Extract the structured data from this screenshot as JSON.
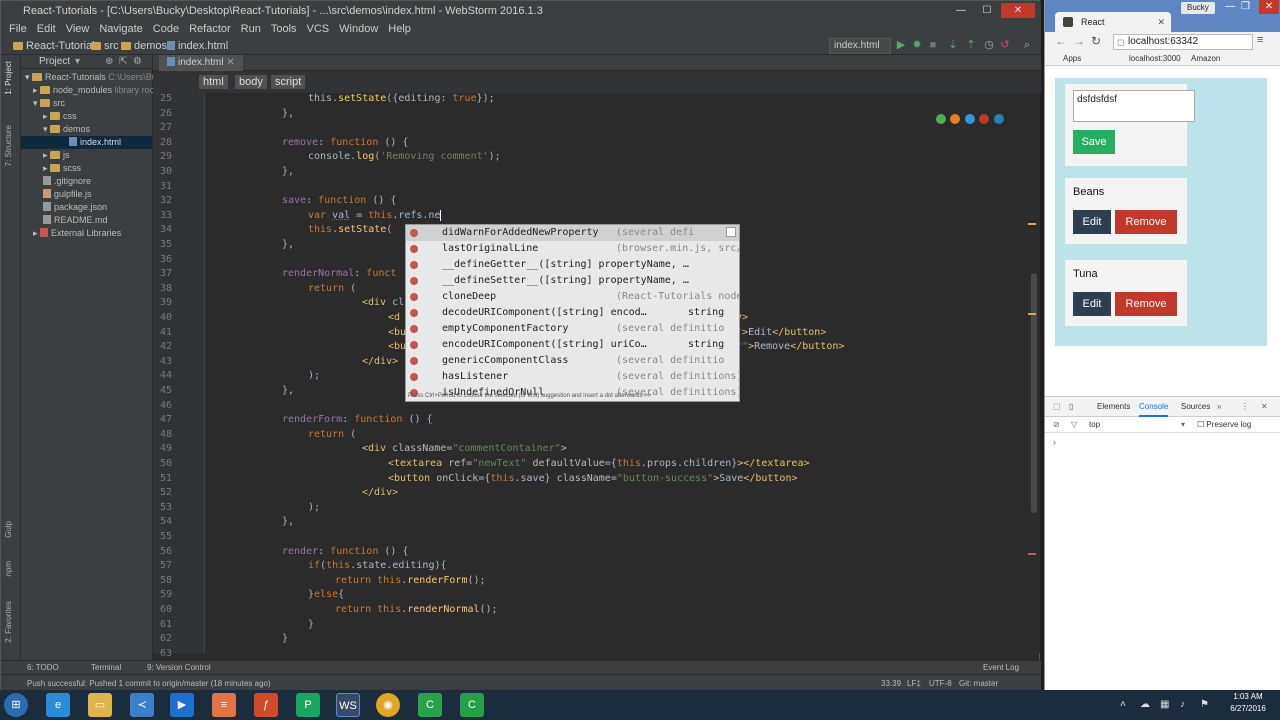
{
  "webstorm": {
    "title": "React-Tutorials - [C:\\Users\\Bucky\\Desktop\\React-Tutorials] - ...\\src\\demos\\index.html - WebStorm 2016.1.3",
    "menu": [
      "File",
      "Edit",
      "View",
      "Navigate",
      "Code",
      "Refactor",
      "Run",
      "Tools",
      "VCS",
      "Window",
      "Help"
    ],
    "navbar": {
      "crumbs": [
        "React-Tutorials",
        "src",
        "demos",
        "index.html"
      ],
      "run_config": "index.html"
    },
    "left_strip_tabs": [
      "1: Project",
      "7: Structure",
      "Gulp",
      "npm",
      "2: Favorites"
    ],
    "project_panel": {
      "title": "Project",
      "tree": [
        {
          "label": "React-Tutorials",
          "suffix": "C:\\Users\\Bu",
          "kind": "folder"
        },
        {
          "label": "node_modules",
          "suffix": "library roc",
          "kind": "folder"
        },
        {
          "label": "src",
          "suffix": "",
          "kind": "folder"
        },
        {
          "label": "css",
          "suffix": "",
          "kind": "folder"
        },
        {
          "label": "demos",
          "suffix": "",
          "kind": "folder"
        },
        {
          "label": "index.html",
          "suffix": "",
          "kind": "file"
        },
        {
          "label": "js",
          "suffix": "",
          "kind": "folder"
        },
        {
          "label": "scss",
          "suffix": "",
          "kind": "folder"
        },
        {
          "label": ".gitignore",
          "suffix": "",
          "kind": "file"
        },
        {
          "label": "gulpfile.js",
          "suffix": "",
          "kind": "file"
        },
        {
          "label": "package.json",
          "suffix": "",
          "kind": "file"
        },
        {
          "label": "README.md",
          "suffix": "",
          "kind": "file"
        },
        {
          "label": "External Libraries",
          "suffix": "",
          "kind": "lib"
        }
      ]
    },
    "editor_tab": "index.html",
    "breadcrumbs": [
      "html",
      "body",
      "script"
    ],
    "line_numbers": [
      "25",
      "26",
      "27",
      "28",
      "29",
      "30",
      "31",
      "32",
      "33",
      "34",
      "35",
      "36",
      "37",
      "38",
      "39",
      "40",
      "41",
      "42",
      "43",
      "44",
      "45",
      "46",
      "47",
      "48",
      "49",
      "50",
      "51",
      "52",
      "53",
      "54",
      "55",
      "56",
      "57",
      "58",
      "59",
      "60",
      "61",
      "62",
      "63"
    ],
    "completion": {
      "items": [
        {
          "name": "didWarnForAddedNewProperty",
          "desc": "(several defi",
          "type": ""
        },
        {
          "name": "lastOriginalLine",
          "desc": "(browser.min.js, src/js)",
          "type": ""
        },
        {
          "name": "__defineGetter__([string] propertyName, …",
          "desc": "",
          "type": ""
        },
        {
          "name": "__defineSetter__([string] propertyName, …",
          "desc": "",
          "type": ""
        },
        {
          "name": "cloneDeep",
          "desc": "(React-Tutorials node_modules)",
          "type": ""
        },
        {
          "name": "decodeURIComponent([string] encod…",
          "desc": "",
          "type": "string"
        },
        {
          "name": "emptyComponentFactory",
          "desc": "(several definitio",
          "type": ""
        },
        {
          "name": "encodeURIComponent([string] uriCo…",
          "desc": "",
          "type": "string"
        },
        {
          "name": "genericComponentClass",
          "desc": "(several definitio",
          "type": ""
        },
        {
          "name": "hasListener",
          "desc": "(several definitions)",
          "type": ""
        },
        {
          "name": "isUndefinedOrNull",
          "desc": "(several definitions)",
          "type": ""
        }
      ],
      "footer": "Press Ctrl+Period to choose the selected (or first) suggestion and insert a dot afterwards  >>"
    },
    "bottom_tools": [
      "6: TODO",
      "Terminal",
      "9: Version Control",
      "Event Log"
    ],
    "status": {
      "message": "Push successful: Pushed 1 commit to origin/master (18 minutes ago)",
      "position": "33:39",
      "line_sep": "LF‡",
      "encoding": "UTF-8",
      "git": "Git: master"
    }
  },
  "chrome": {
    "tab_title": "React",
    "user": "Bucky",
    "url": "localhost:63342",
    "bookmarks": [
      "Apps",
      "localhost:3000",
      "Amazon"
    ],
    "app": {
      "edit_card": {
        "text": "dsfdsfdsf",
        "button": "Save"
      },
      "comments": [
        {
          "text": "Beans",
          "edit": "Edit",
          "remove": "Remove"
        },
        {
          "text": "Tuna",
          "edit": "Edit",
          "remove": "Remove"
        }
      ]
    },
    "devtools": {
      "tabs": [
        "Elements",
        "Console",
        "Sources"
      ],
      "context": "top",
      "preserve_log": "Preserve log"
    }
  },
  "taskbar": {
    "time": "1:03 AM",
    "date": "6/27/2016"
  }
}
